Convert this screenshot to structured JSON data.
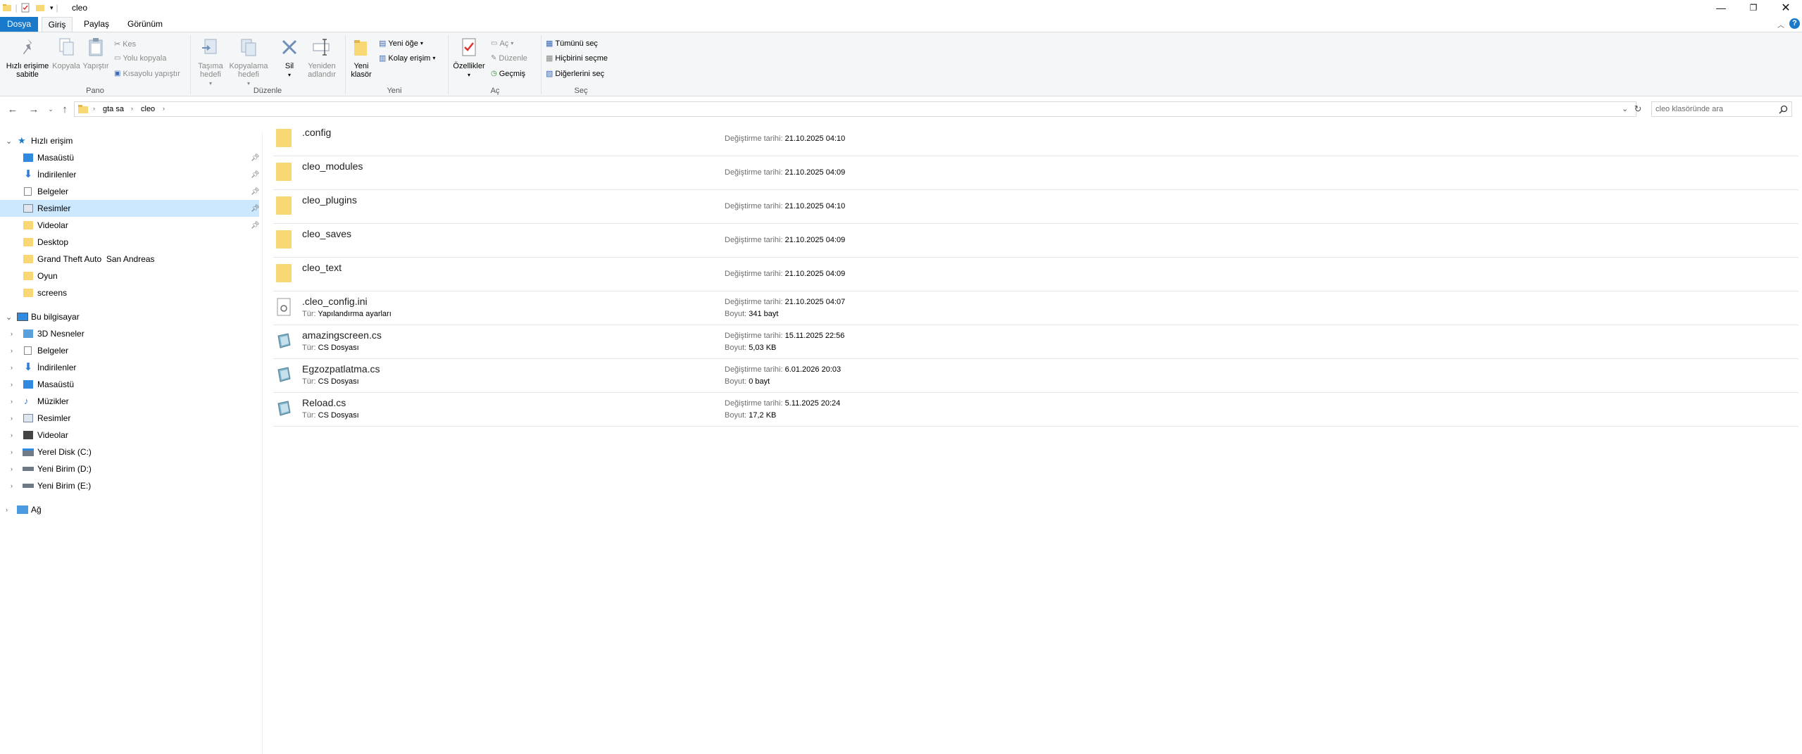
{
  "window": {
    "title": "cleo"
  },
  "tabs": [
    {
      "label": "Dosya"
    },
    {
      "label": "Giriş"
    },
    {
      "label": "Paylaş"
    },
    {
      "label": "Görünüm"
    }
  ],
  "ribbon": {
    "pano": {
      "title": "Pano",
      "pin": "Hızlı erişime sabitle",
      "copy": "Kopyala",
      "paste": "Yapıştır",
      "cut": "Kes",
      "copy_path": "Yolu kopyala",
      "paste_shortcut": "Kısayolu yapıştır"
    },
    "duzenle": {
      "title": "Düzenle",
      "move_to": "Taşıma hedefi",
      "copy_to": "Kopyalama hedefi",
      "delete": "Sil",
      "rename": "Yeniden adlandır"
    },
    "yeni": {
      "title": "Yeni",
      "new_folder": "Yeni klasör",
      "new_item": "Yeni öğe",
      "easy_access": "Kolay erişim"
    },
    "ac": {
      "title": "Aç",
      "properties": "Özellikler",
      "open": "Aç",
      "edit": "Düzenle",
      "history": "Geçmiş"
    },
    "sec": {
      "title": "Seç",
      "select_all": "Tümünü seç",
      "select_none": "Hiçbirini seçme",
      "invert": "Diğerlerini seç"
    }
  },
  "address": {
    "crumbs": [
      "gta sa",
      "cleo"
    ],
    "search_placeholder": "cleo klasöründe ara"
  },
  "nav": {
    "quick_access": "Hızlı erişim",
    "quick_items": [
      {
        "label": "Masaüstü",
        "pinned": true
      },
      {
        "label": "İndirilenler",
        "pinned": true
      },
      {
        "label": "Belgeler",
        "pinned": true
      },
      {
        "label": "Resimler",
        "pinned": true,
        "selected": true
      },
      {
        "label": "Videolar",
        "pinned": true
      },
      {
        "label": "Desktop"
      },
      {
        "label": "Grand Theft Auto  San Andreas"
      },
      {
        "label": "Oyun"
      },
      {
        "label": "screens"
      }
    ],
    "this_pc": "Bu bilgisayar",
    "pc_items": [
      {
        "label": "3D Nesneler"
      },
      {
        "label": "Belgeler"
      },
      {
        "label": "İndirilenler"
      },
      {
        "label": "Masaüstü"
      },
      {
        "label": "Müzikler"
      },
      {
        "label": "Resimler"
      },
      {
        "label": "Videolar"
      },
      {
        "label": "Yerel Disk (C:)"
      },
      {
        "label": "Yeni Birim (D:)"
      },
      {
        "label": "Yeni Birim (E:)"
      }
    ],
    "network": "Ağ"
  },
  "labels": {
    "modified": "Değiştirme tarihi:",
    "type": "Tür:",
    "size": "Boyut:"
  },
  "files": [
    {
      "name": ".config",
      "kind": "folder",
      "modified": "21.10.2025 04:10"
    },
    {
      "name": "cleo_modules",
      "kind": "folder",
      "modified": "21.10.2025 04:09"
    },
    {
      "name": "cleo_plugins",
      "kind": "folder",
      "modified": "21.10.2025 04:10"
    },
    {
      "name": "cleo_saves",
      "kind": "folder",
      "modified": "21.10.2025 04:09"
    },
    {
      "name": "cleo_text",
      "kind": "folder",
      "modified": "21.10.2025 04:09"
    },
    {
      "name": ".cleo_config.ini",
      "kind": "ini",
      "type": "Yapılandırma ayarları",
      "modified": "21.10.2025 04:07",
      "size": "341 bayt"
    },
    {
      "name": "amazingscreen.cs",
      "kind": "cs",
      "type": "CS Dosyası",
      "modified": "15.11.2025 22:56",
      "size": "5,03 KB"
    },
    {
      "name": "Egzozpatlatma.cs",
      "kind": "cs",
      "type": "CS Dosyası",
      "modified": "6.01.2026 20:03",
      "size": "0 bayt"
    },
    {
      "name": "Reload.cs",
      "kind": "cs",
      "type": "CS Dosyası",
      "modified": "5.11.2025 20:24",
      "size": "17,2 KB"
    }
  ]
}
